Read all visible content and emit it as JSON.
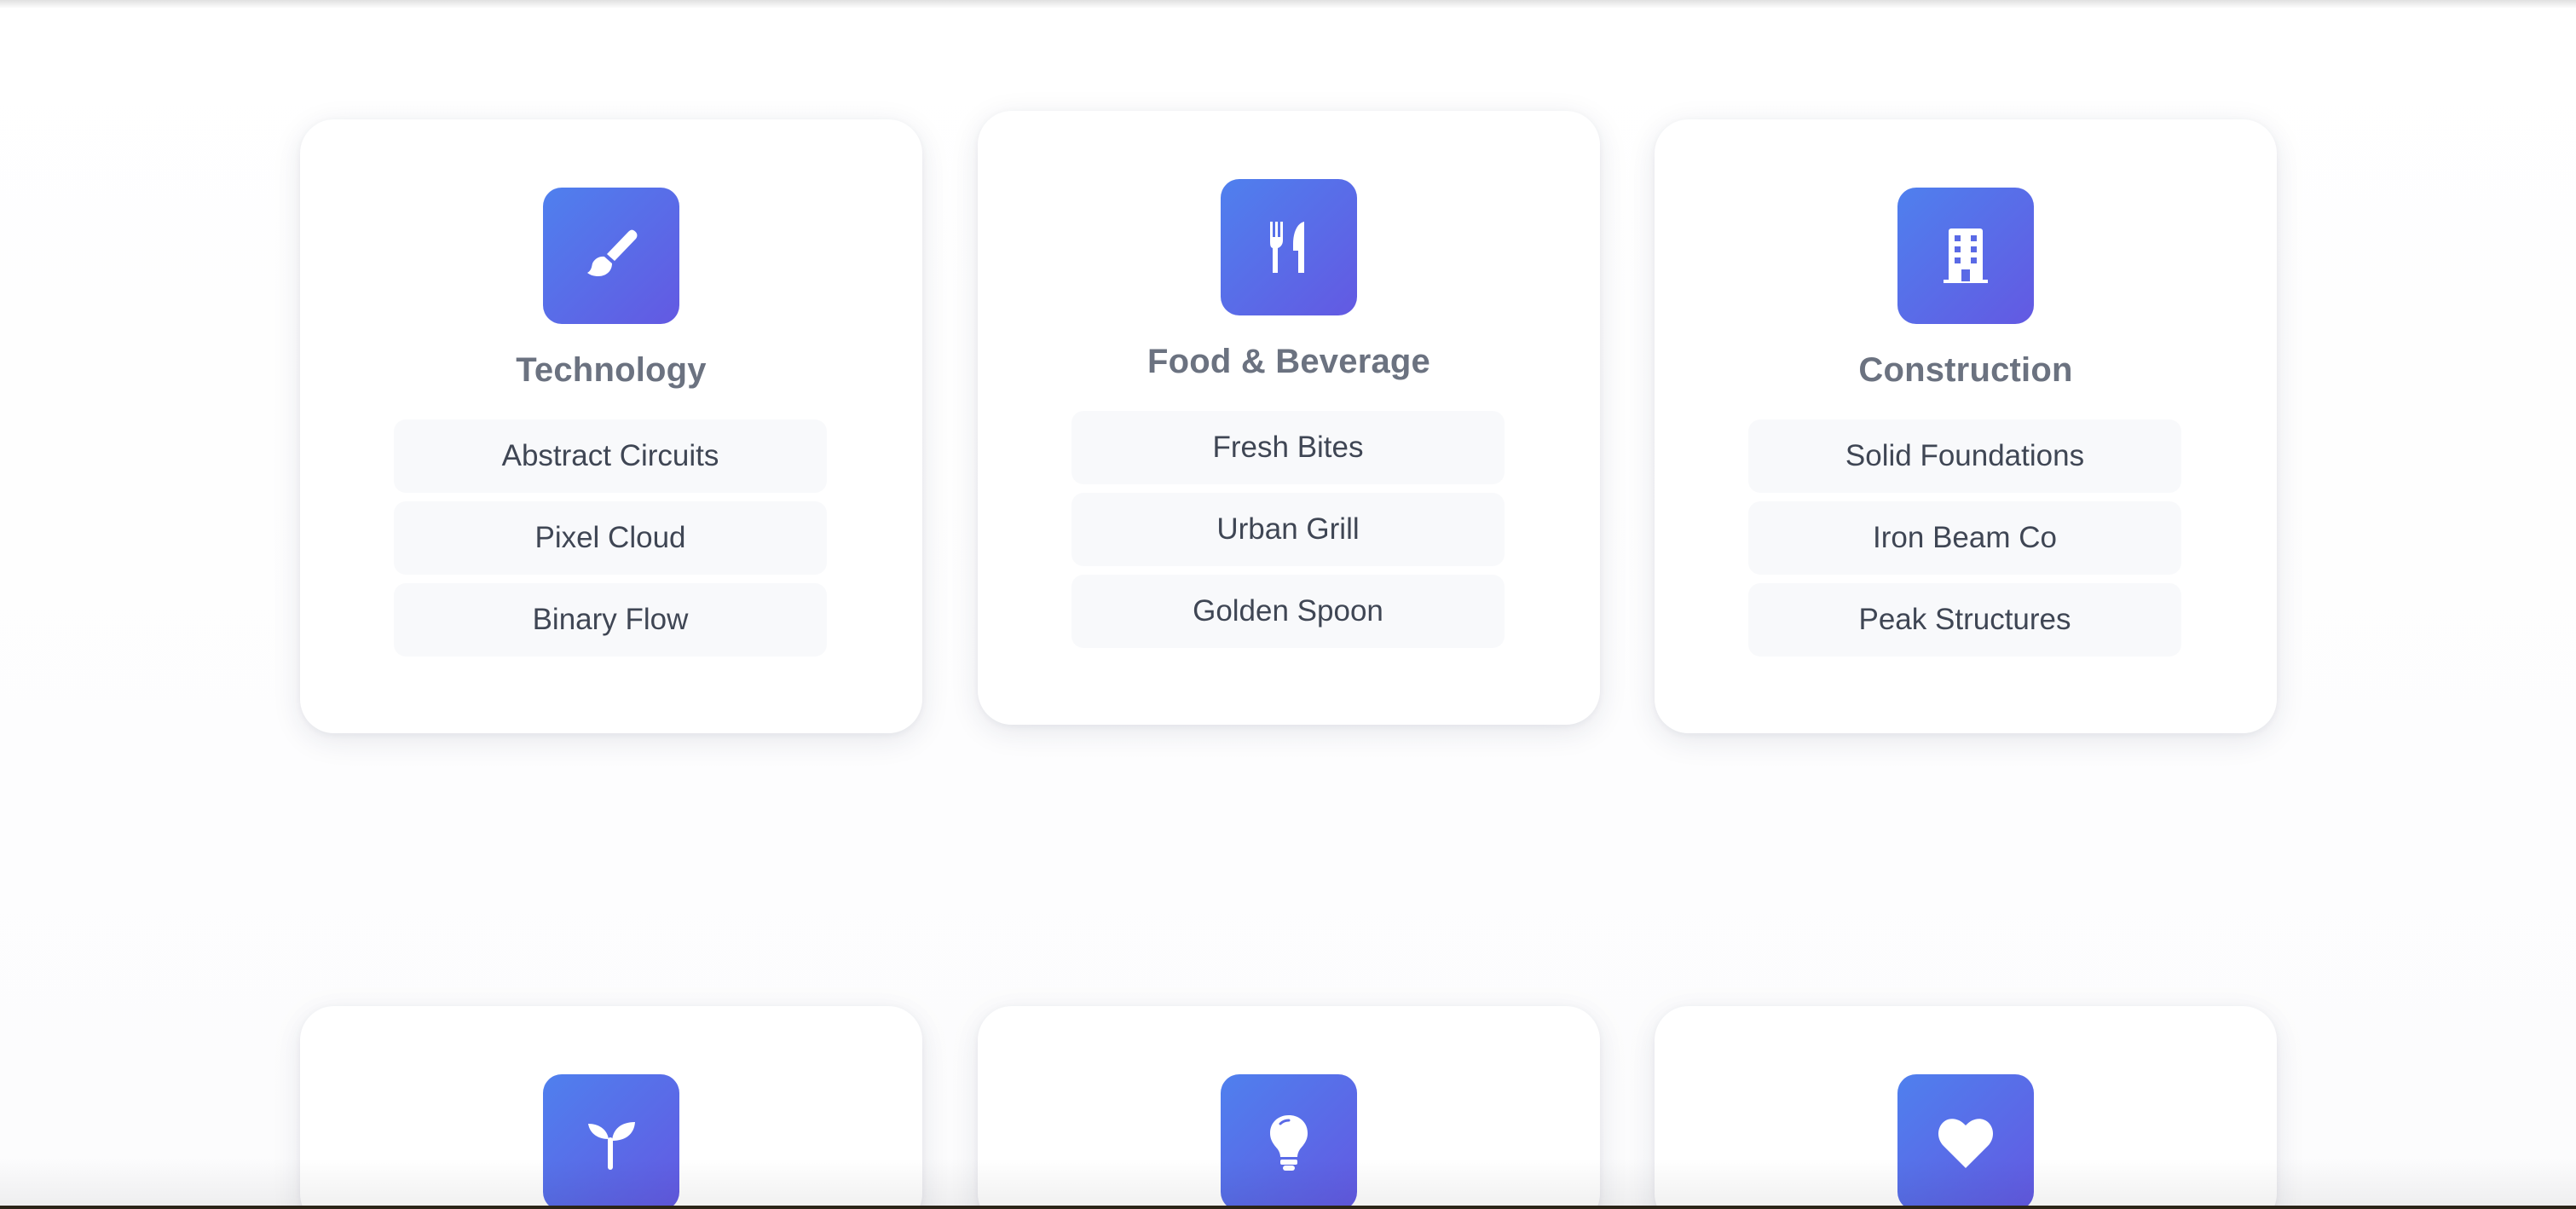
{
  "categories": [
    {
      "title": "Technology",
      "icon": "paintbrush-icon",
      "items": [
        "Abstract Circuits",
        "Pixel Cloud",
        "Binary Flow"
      ]
    },
    {
      "title": "Food & Beverage",
      "icon": "fork-knife-icon",
      "items": [
        "Fresh Bites",
        "Urban Grill",
        "Golden Spoon"
      ]
    },
    {
      "title": "Construction",
      "icon": "building-icon",
      "items": [
        "Solid Foundations",
        "Iron Beam Co",
        "Peak Structures"
      ]
    },
    {
      "icon": "seedling-icon"
    },
    {
      "icon": "lightbulb-icon"
    },
    {
      "icon": "heart-icon"
    }
  ],
  "colors": {
    "icon_gradient_start": "#4f80ee",
    "icon_gradient_end": "#6359e2",
    "title": "#6b7280",
    "item_bg": "#f8f9fb",
    "item_text": "#3f4654"
  }
}
